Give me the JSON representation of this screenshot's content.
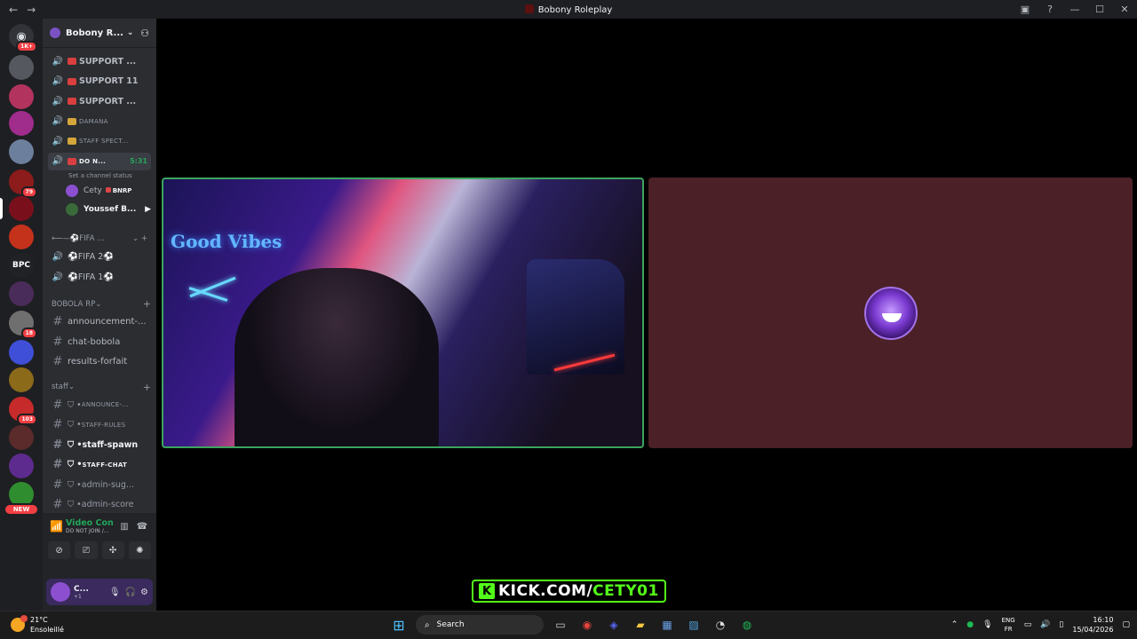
{
  "window": {
    "title": "Bobony Roleplay"
  },
  "colors": {
    "speaking_green": "#3ba55d",
    "kick_green": "#53fc18",
    "avatar_tile_bg": "#4b2127",
    "sidebar_bg": "#2b2d31"
  },
  "servers": {
    "home_badge": "1K+",
    "items": [
      {
        "name": "server-1",
        "color": "#55595f"
      },
      {
        "name": "server-2",
        "color": "#b2345e"
      },
      {
        "name": "server-3",
        "color": "#a02c8c"
      },
      {
        "name": "server-4",
        "color": "#6c7f9c"
      },
      {
        "name": "server-5",
        "color": "#8c1c1c",
        "badge": "79"
      },
      {
        "name": "server-bobony",
        "color": "#7a0f1c",
        "active": true
      },
      {
        "name": "server-7",
        "color": "#c5321b"
      },
      {
        "name": "server-bpc",
        "color": "#202225",
        "label": "BPC"
      },
      {
        "name": "server-9",
        "color": "#4a2c5a"
      },
      {
        "name": "server-10",
        "color": "#6f6f6f",
        "badge": "18"
      },
      {
        "name": "server-11",
        "color": "#3f4fd8"
      },
      {
        "name": "server-12",
        "color": "#8b6a1a"
      },
      {
        "name": "server-13",
        "color": "#c62a2a",
        "badge": "103"
      },
      {
        "name": "server-14",
        "color": "#5b2a2a"
      },
      {
        "name": "server-15",
        "color": "#5d2b8d"
      },
      {
        "name": "server-16",
        "color": "#2f8d2f",
        "badge": "NEW"
      }
    ]
  },
  "sidebar": {
    "server_name": "Bobony R...",
    "voice_channels": [
      {
        "label": "SUPPORT ...",
        "emoji": "sos"
      },
      {
        "label": "SUPPORT 11",
        "emoji": "sos"
      },
      {
        "label": "SUPPORT ...",
        "emoji": "sos"
      },
      {
        "label": "DAMANA",
        "emoji": "gift"
      },
      {
        "label": "STAFF SPECT...",
        "emoji": "gift"
      }
    ],
    "active_channel": {
      "label": "DO N...",
      "timer": "5:31",
      "status_hint": "Set a channel status"
    },
    "members": [
      {
        "name": "Cety",
        "tag": "BNRP"
      },
      {
        "name": "Youssef B..."
      }
    ],
    "fifa_category": "FIFA ...",
    "fifa_channels": [
      "FIFA 2",
      "FIFA 1"
    ],
    "bobola_category": "BOBOLA RP",
    "bobola_channels": [
      "announcement-...",
      "chat-bobola",
      "results-forfait"
    ],
    "staff_category": "staff",
    "staff_channels": [
      {
        "label": "ANNOUNCE-...",
        "bold": false
      },
      {
        "label": "STAFF-RULES",
        "bold": false
      },
      {
        "label": "staff-spawn",
        "bold": true
      },
      {
        "label": "STAFF-CHAT",
        "bold": true
      },
      {
        "label": "admin-sug...",
        "bold": false
      },
      {
        "label": "admin-score",
        "bold": false
      }
    ]
  },
  "voice_panel": {
    "status": "Video Connected",
    "channel": "DO NOT JOIN /..."
  },
  "user_panel": {
    "name": "C...",
    "sub": "+1"
  },
  "stream": {
    "neon_text": "Good Vibes",
    "kick_icon": "K",
    "kick_prefix": "KICK.COM/",
    "kick_user": "CETY01"
  },
  "taskbar": {
    "weather_temp": "21°C",
    "weather_desc": "Ensoleillé",
    "search_placeholder": "Search",
    "lang_top": "ENG",
    "lang_bottom": "FR",
    "time": "16:10",
    "date": "15/04/2026"
  }
}
